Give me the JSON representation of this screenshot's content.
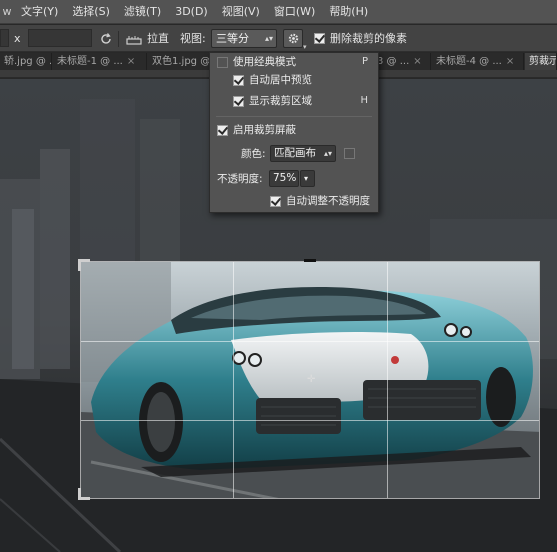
{
  "menubar": {
    "logo": "w",
    "items": [
      "文字(Y)",
      "选择(S)",
      "滤镜(T)",
      "3D(D)",
      "视图(V)",
      "窗口(W)",
      "帮助(H)"
    ]
  },
  "options": {
    "size_separator": "x",
    "straighten_label": "拉直",
    "view_label": "视图:",
    "view_value": "三等分",
    "delete_pixels_label": "删除裁剪的像素",
    "delete_pixels_checked": true
  },
  "tabs": [
    {
      "label": "轿.jpg @ ...",
      "close": "×",
      "active": false
    },
    {
      "label": "未标题-1 @ ...",
      "close": "×",
      "active": false
    },
    {
      "label": "双色1.jpg @ ...",
      "close": "×",
      "active": false
    },
    {
      "label": "3 @ ...",
      "close": "×",
      "active": false
    },
    {
      "label": "未标题-4 @ ...",
      "close": "×",
      "active": false
    },
    {
      "label": "剪裁示",
      "close": "",
      "active": true
    }
  ],
  "panel": {
    "classic_mode": {
      "label": "使用经典模式",
      "shortcut": "P",
      "checked": false
    },
    "auto_center": {
      "label": "自动居中预览",
      "checked": true
    },
    "show_cropped": {
      "label": "显示裁剪区域",
      "shortcut": "H",
      "checked": true
    },
    "enable_shield": {
      "label": "启用裁剪屏蔽",
      "checked": true
    },
    "color_label": "颜色:",
    "color_value": "匹配画布",
    "opacity_label": "不透明度:",
    "opacity_value": "75%",
    "auto_adjust": {
      "label": "自动调整不透明度",
      "checked": true
    }
  },
  "colors": {
    "menubar": "#535353",
    "optionsbar": "#434343",
    "panel": "#535353",
    "car_teal": "#2f7f8c"
  }
}
